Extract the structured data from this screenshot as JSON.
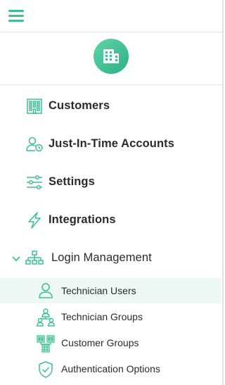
{
  "colors": {
    "accent": "#3cbf92",
    "text": "#2b2b2b",
    "active_bg": "#edf7f3"
  },
  "header": {
    "menu_icon": "hamburger-menu-icon"
  },
  "logo": {
    "icon": "building-icon"
  },
  "nav": [
    {
      "label": "Customers",
      "icon": "building-icon"
    },
    {
      "label": "Just-In-Time Accounts",
      "icon": "user-clock-icon"
    },
    {
      "label": "Settings",
      "icon": "sliders-icon"
    },
    {
      "label": "Integrations",
      "icon": "lightning-icon"
    }
  ],
  "section": {
    "label": "Login Management",
    "icon": "hierarchy-icon",
    "expanded": true,
    "items": [
      {
        "label": "Technician Users",
        "icon": "user-icon",
        "active": true
      },
      {
        "label": "Technician Groups",
        "icon": "user-group-icon",
        "active": false
      },
      {
        "label": "Customer Groups",
        "icon": "buildings-icon",
        "active": false
      },
      {
        "label": "Authentication Options",
        "icon": "shield-check-icon",
        "active": false
      }
    ]
  }
}
